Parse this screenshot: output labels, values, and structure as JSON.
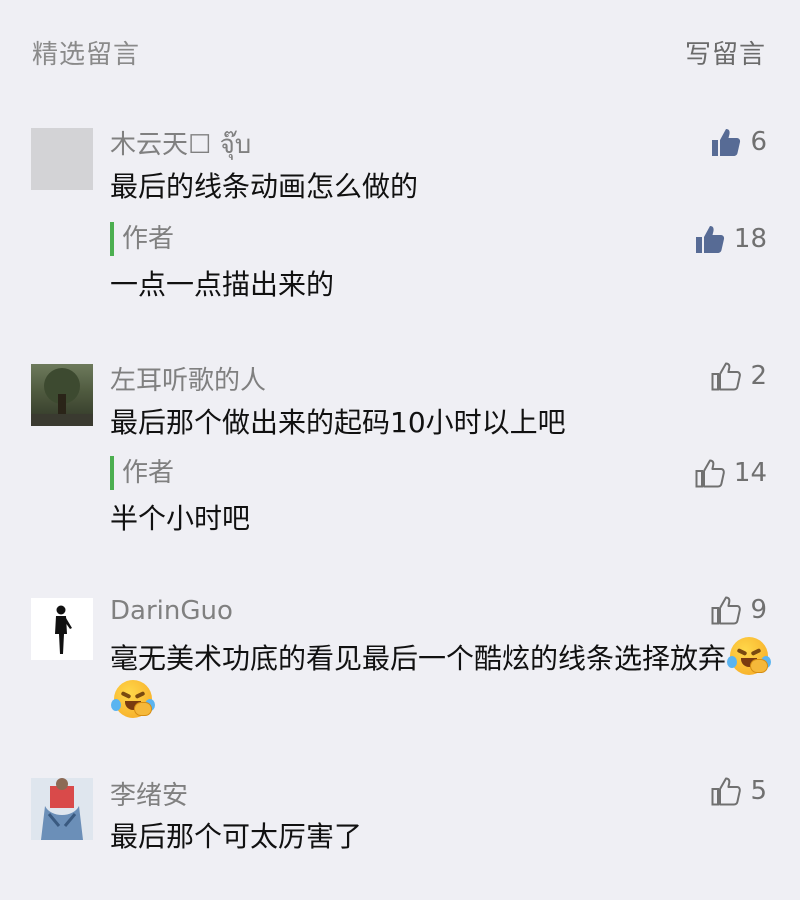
{
  "header": {
    "title": "精选留言",
    "write_label": "写留言"
  },
  "icons": {
    "like_filled": "thumbs-up-filled-icon",
    "like_outline": "thumbs-up-outline-icon",
    "emoji": "face-with-tears-of-joy-icon"
  },
  "colors": {
    "background": "#efeff4",
    "liked": "#576b95",
    "author_bar": "#4caf50",
    "muted_text": "#808080"
  },
  "comments": [
    {
      "nickname": "木云天☐ จุ๊บ",
      "text": "最后的线条动画怎么做的",
      "likes": "6",
      "liked": true,
      "reply": {
        "label": "作者",
        "text": "一点一点描出来的",
        "likes": "18",
        "liked": true
      }
    },
    {
      "nickname": "左耳听歌的人",
      "text": "最后那个做出来的起码10小时以上吧",
      "likes": "2",
      "liked": false,
      "reply": {
        "label": "作者",
        "text": "半个小时吧",
        "likes": "14",
        "liked": false
      }
    },
    {
      "nickname": "DarinGuo",
      "text": "毫无美术功底的看见最后一个酷炫的线条选择放弃",
      "likes": "9",
      "liked": false
    },
    {
      "nickname": "李绪安",
      "text": "最后那个可太厉害了",
      "likes": "5",
      "liked": false
    }
  ]
}
